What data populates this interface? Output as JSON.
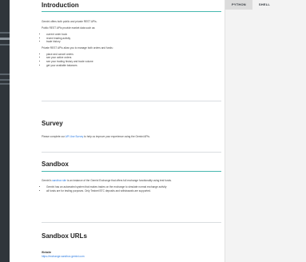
{
  "lang_tabs": [
    "PYTHON",
    "SHELL"
  ],
  "intro": {
    "title": "Introduction",
    "p1": "Gemini offers both public and private REST APIs.",
    "p2": "Public REST APIs provide market data such as:",
    "public_items": [
      "current order book",
      "recent trading activity",
      "trade history"
    ],
    "p3": "Private REST APIs allow you to manage both orders and funds:",
    "private_items": [
      "place and cancel orders",
      "see your active orders",
      "see your trading history and trade volume",
      "get your available balances"
    ]
  },
  "survey": {
    "title": "Survey",
    "text_before": "Please complete our ",
    "link": "API Use Survey",
    "text_after": " to help us improve your experience using the Gemini APIs."
  },
  "sandbox": {
    "title": "Sandbox",
    "text_before": "Gemini's ",
    "link": "sandbox site",
    "text_after": " is an instance of the Gemini Exchange that offers full exchange functionality using test funds.",
    "items": [
      "Gemini has an automated system that makes trades on the exchange to simulate normal exchange activity",
      "all funds are for testing purposes. Only Testnet BTC deposits and withdrawals are supported."
    ]
  },
  "sandbox_urls": {
    "title": "Sandbox URLs",
    "website_label": "Website",
    "website_url": "https://exchange.sandbox.gemini.com"
  },
  "colors": {
    "nav_bg": "#2f353b",
    "accent_teal": "#47b8b0",
    "link_blue": "#2a7ae2"
  }
}
